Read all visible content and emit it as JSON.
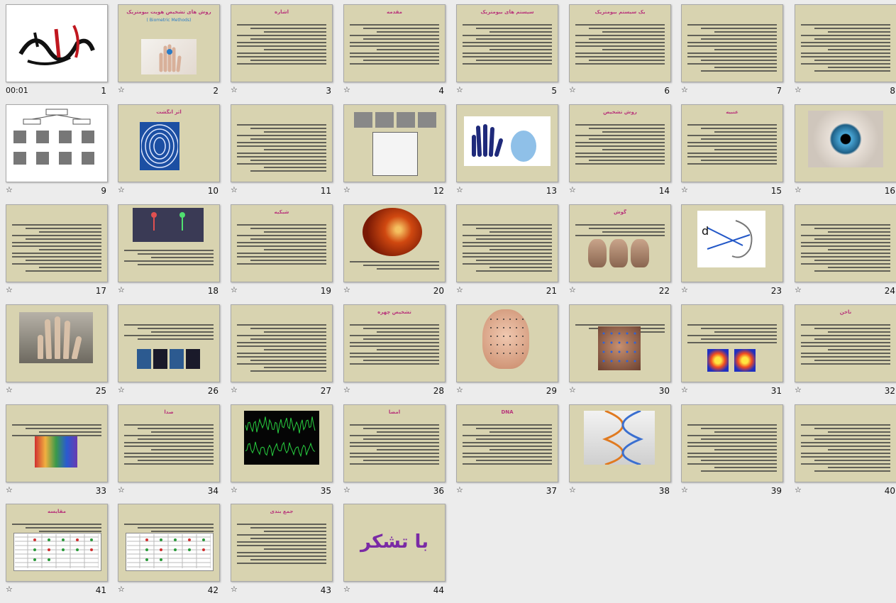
{
  "sorter": {
    "first_timing": "00:01",
    "star_glyph": "☆",
    "slides": [
      {
        "n": "1",
        "title": "",
        "kind": "calligraphy"
      },
      {
        "n": "2",
        "title": "روش های تشخیص هویت بیومتریک",
        "sub": "( Biometric Methods)",
        "kind": "title"
      },
      {
        "n": "3",
        "title": "اشاره",
        "kind": "text"
      },
      {
        "n": "4",
        "title": "مقدمه",
        "kind": "text"
      },
      {
        "n": "5",
        "title": "سیستم های بیومتریک",
        "kind": "text"
      },
      {
        "n": "6",
        "title": "یک سیستم بیومتریک",
        "kind": "text"
      },
      {
        "n": "7",
        "title": "",
        "kind": "text"
      },
      {
        "n": "8",
        "title": "",
        "kind": "text"
      },
      {
        "n": "9",
        "title": "",
        "kind": "tree"
      },
      {
        "n": "10",
        "title": "اثر انگشت",
        "kind": "fingerprint"
      },
      {
        "n": "11",
        "title": "",
        "kind": "text"
      },
      {
        "n": "12",
        "title": "",
        "kind": "prints"
      },
      {
        "n": "13",
        "title": "",
        "kind": "hands"
      },
      {
        "n": "14",
        "title": "روش تشخیص",
        "kind": "text"
      },
      {
        "n": "15",
        "title": "عنبیه",
        "kind": "text"
      },
      {
        "n": "16",
        "title": "",
        "kind": "eye"
      },
      {
        "n": "17",
        "title": "",
        "kind": "text"
      },
      {
        "n": "18",
        "title": "",
        "kind": "gait"
      },
      {
        "n": "19",
        "title": "شبکیه",
        "kind": "text"
      },
      {
        "n": "20",
        "title": "",
        "kind": "retina"
      },
      {
        "n": "21",
        "title": "",
        "kind": "text"
      },
      {
        "n": "22",
        "title": "گوش",
        "kind": "ears"
      },
      {
        "n": "23",
        "title": "",
        "kind": "eardiagram"
      },
      {
        "n": "24",
        "title": "",
        "kind": "text"
      },
      {
        "n": "25",
        "title": "",
        "kind": "handgeo"
      },
      {
        "n": "26",
        "title": "",
        "kind": "veins"
      },
      {
        "n": "27",
        "title": "",
        "kind": "text"
      },
      {
        "n": "28",
        "title": "تشخیص چهره",
        "kind": "text"
      },
      {
        "n": "29",
        "title": "",
        "kind": "face"
      },
      {
        "n": "30",
        "title": "",
        "kind": "face2"
      },
      {
        "n": "31",
        "title": "",
        "kind": "thermal"
      },
      {
        "n": "32",
        "title": "ناخن",
        "kind": "text"
      },
      {
        "n": "33",
        "title": "",
        "kind": "skin"
      },
      {
        "n": "34",
        "title": "صدا",
        "kind": "text"
      },
      {
        "n": "35",
        "title": "",
        "kind": "wave"
      },
      {
        "n": "36",
        "title": "امضا",
        "kind": "text"
      },
      {
        "n": "37",
        "title": "DNA",
        "kind": "text"
      },
      {
        "n": "38",
        "title": "",
        "kind": "dna"
      },
      {
        "n": "39",
        "title": "",
        "kind": "text"
      },
      {
        "n": "40",
        "title": "",
        "kind": "text"
      },
      {
        "n": "41",
        "title": "مقایسه",
        "kind": "table"
      },
      {
        "n": "42",
        "title": "",
        "kind": "table2"
      },
      {
        "n": "43",
        "title": "جمع بندی",
        "kind": "text"
      },
      {
        "n": "44",
        "title": "",
        "kind": "thanks",
        "big": "با تشکر"
      }
    ]
  }
}
